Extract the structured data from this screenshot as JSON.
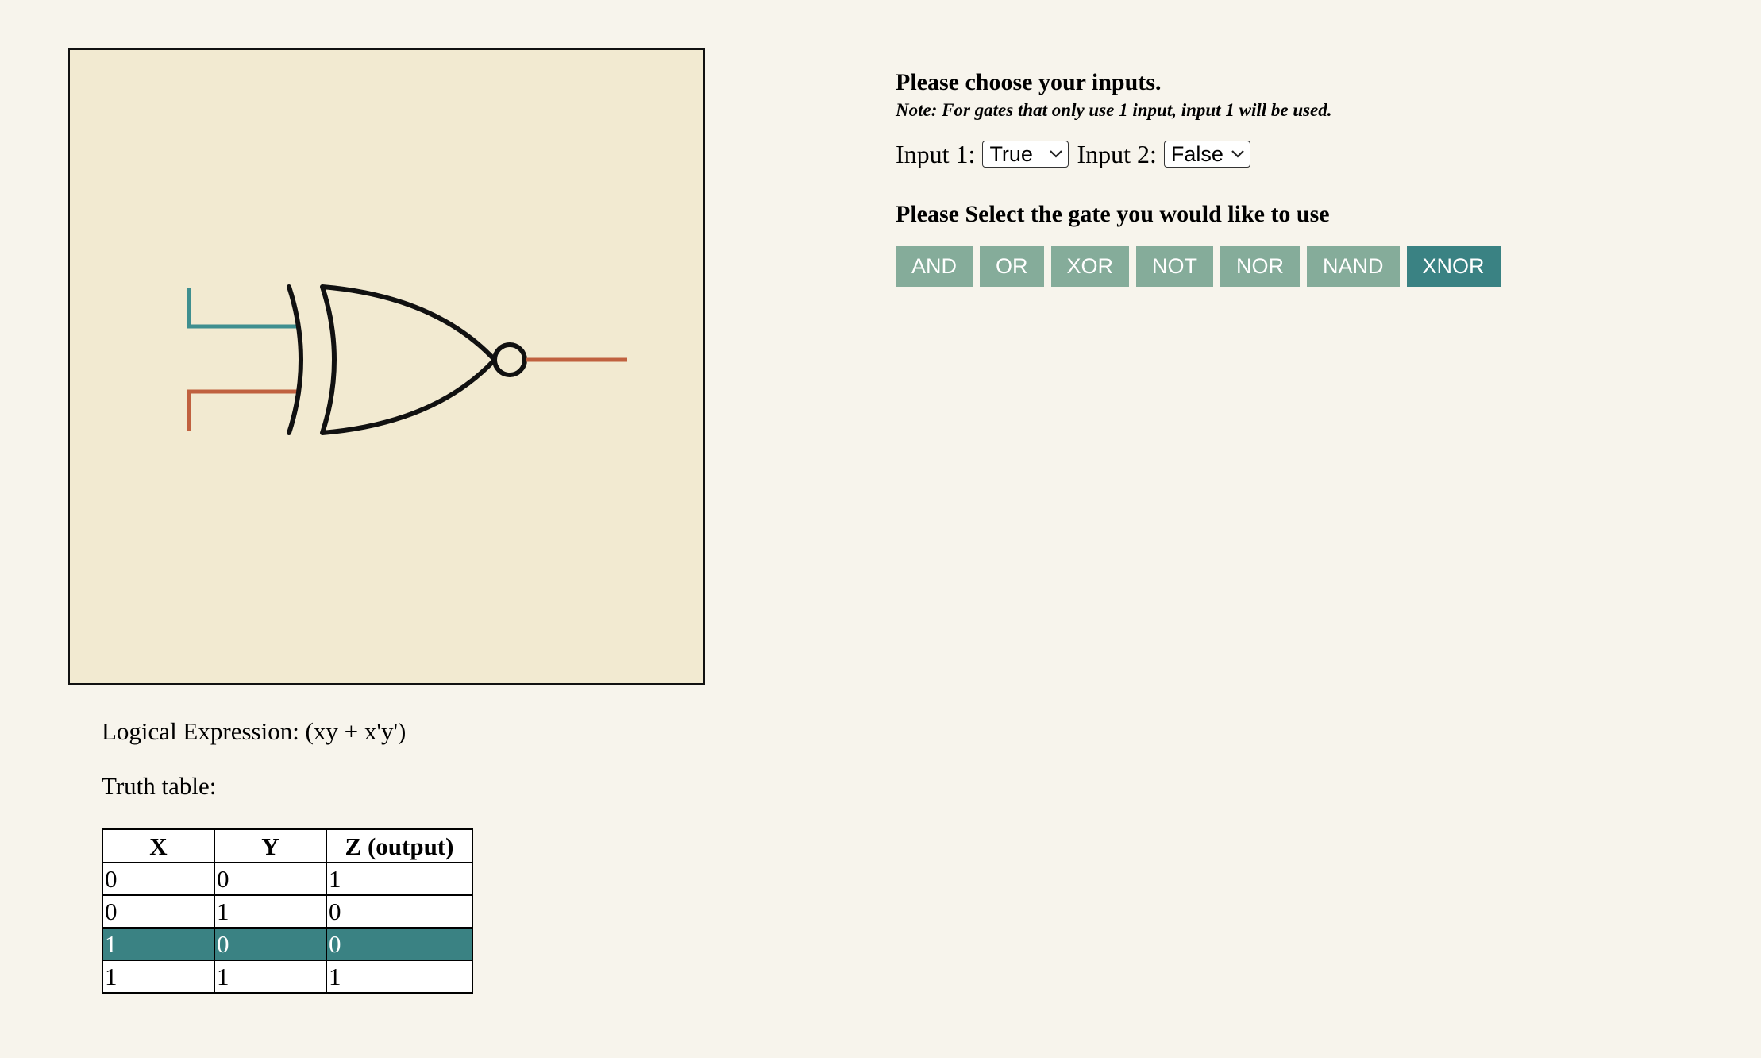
{
  "gate_display": {
    "selected_gate": "XNOR",
    "colors": {
      "canvas_bg": "#f2ead1",
      "input1_wire": "#3f8f8f",
      "input2_wire": "#c0613f",
      "output_wire": "#c0613f",
      "gate_stroke": "#111111"
    }
  },
  "expression": {
    "label": "Logical Expression: (xy + x'y')"
  },
  "truth_table": {
    "label": "Truth table:",
    "headers": [
      "X",
      "Y",
      "Z (output)"
    ],
    "rows": [
      [
        "0",
        "0",
        "1"
      ],
      [
        "0",
        "1",
        "0"
      ],
      [
        "1",
        "0",
        "0"
      ],
      [
        "1",
        "1",
        "1"
      ]
    ],
    "highlighted_row": 2,
    "highlight_color": "#3a8283"
  },
  "controls": {
    "heading": "Please choose your inputs.",
    "note": "Note: For gates that only use 1 input, input 1 will be used.",
    "input1_label": "Input 1:",
    "input1_value": "True",
    "input2_label": "Input 2:",
    "input2_value": "False",
    "gate_heading": "Please Select the gate you would like to use",
    "gates": [
      {
        "label": "AND",
        "active": false
      },
      {
        "label": "OR",
        "active": false
      },
      {
        "label": "XOR",
        "active": false
      },
      {
        "label": "NOT",
        "active": false
      },
      {
        "label": "NOR",
        "active": false
      },
      {
        "label": "NAND",
        "active": false
      },
      {
        "label": "XNOR",
        "active": true
      }
    ],
    "button_color": "#85ac9a",
    "button_active_color": "#3a8283"
  }
}
